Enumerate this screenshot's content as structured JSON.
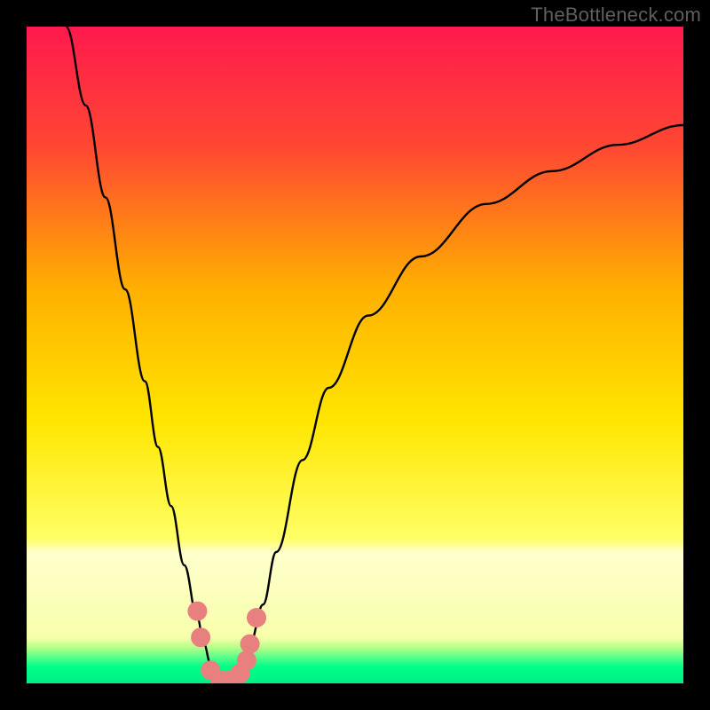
{
  "watermark": "TheBottleneck.com",
  "chart_data": {
    "type": "line",
    "title": "",
    "xlabel": "",
    "ylabel": "",
    "xlim": [
      0,
      100
    ],
    "ylim": [
      0,
      100
    ],
    "background_gradient": {
      "stops": [
        {
          "offset": 0.0,
          "color": "#ff1a4d"
        },
        {
          "offset": 0.18,
          "color": "#ff4633"
        },
        {
          "offset": 0.4,
          "color": "#ffb000"
        },
        {
          "offset": 0.6,
          "color": "#ffe600"
        },
        {
          "offset": 0.78,
          "color": "#ffff66"
        },
        {
          "offset": 0.8,
          "color": "#ffffcc"
        },
        {
          "offset": 0.93,
          "color": "#f8ffab"
        },
        {
          "offset": 0.945,
          "color": "#b8ff8a"
        },
        {
          "offset": 0.96,
          "color": "#5aff8a"
        },
        {
          "offset": 0.975,
          "color": "#00ff88"
        },
        {
          "offset": 1.0,
          "color": "#00ee85"
        }
      ]
    },
    "series": [
      {
        "name": "bottleneck-curve",
        "color": "#000000",
        "x": [
          6,
          9,
          12,
          15,
          18,
          20,
          22,
          24,
          26,
          27,
          28,
          29,
          30,
          31,
          32,
          33,
          34,
          36,
          38,
          42,
          46,
          52,
          60,
          70,
          80,
          90,
          100
        ],
        "y": [
          100,
          88,
          74,
          60,
          46,
          36,
          27,
          18,
          10,
          6,
          3,
          1,
          0,
          0,
          1,
          3,
          6,
          12,
          20,
          34,
          45,
          56,
          65,
          73,
          78,
          82,
          85
        ]
      }
    ],
    "markers": {
      "name": "highlighted-points",
      "color": "#e98080",
      "points": [
        {
          "x": 26.0,
          "y": 11
        },
        {
          "x": 26.5,
          "y": 7
        },
        {
          "x": 28.0,
          "y": 2
        },
        {
          "x": 29.5,
          "y": 0.5
        },
        {
          "x": 31.0,
          "y": 0.5
        },
        {
          "x": 32.5,
          "y": 1.5
        },
        {
          "x": 33.5,
          "y": 3.5
        },
        {
          "x": 34.0,
          "y": 6
        },
        {
          "x": 35.0,
          "y": 10
        }
      ]
    }
  }
}
